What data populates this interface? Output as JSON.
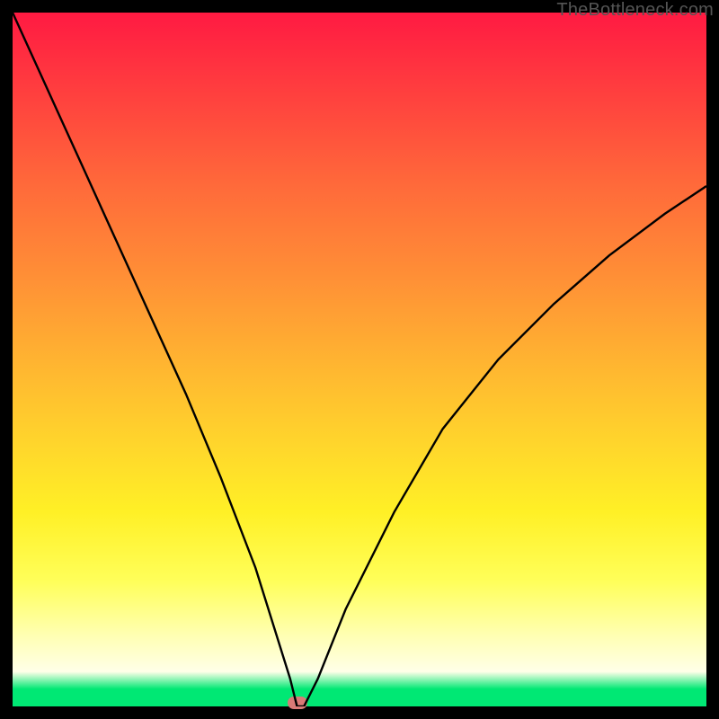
{
  "watermark": "TheBottleneck.com",
  "chart_data": {
    "type": "line",
    "title": "",
    "xlabel": "",
    "ylabel": "",
    "xlim": [
      0,
      100
    ],
    "ylim": [
      0,
      100
    ],
    "x": [
      0,
      5,
      10,
      15,
      20,
      25,
      30,
      35,
      40,
      41,
      42,
      44,
      48,
      55,
      62,
      70,
      78,
      86,
      94,
      100
    ],
    "values": [
      100,
      89,
      78,
      67,
      56,
      45,
      33,
      20,
      4,
      0,
      0,
      4,
      14,
      28,
      40,
      50,
      58,
      65,
      71,
      75
    ],
    "marker": {
      "x": 41,
      "y": 0
    },
    "annotations": []
  },
  "colors": {
    "curve": "#000000",
    "marker": "#d97a77",
    "green_band": "#00e874"
  }
}
